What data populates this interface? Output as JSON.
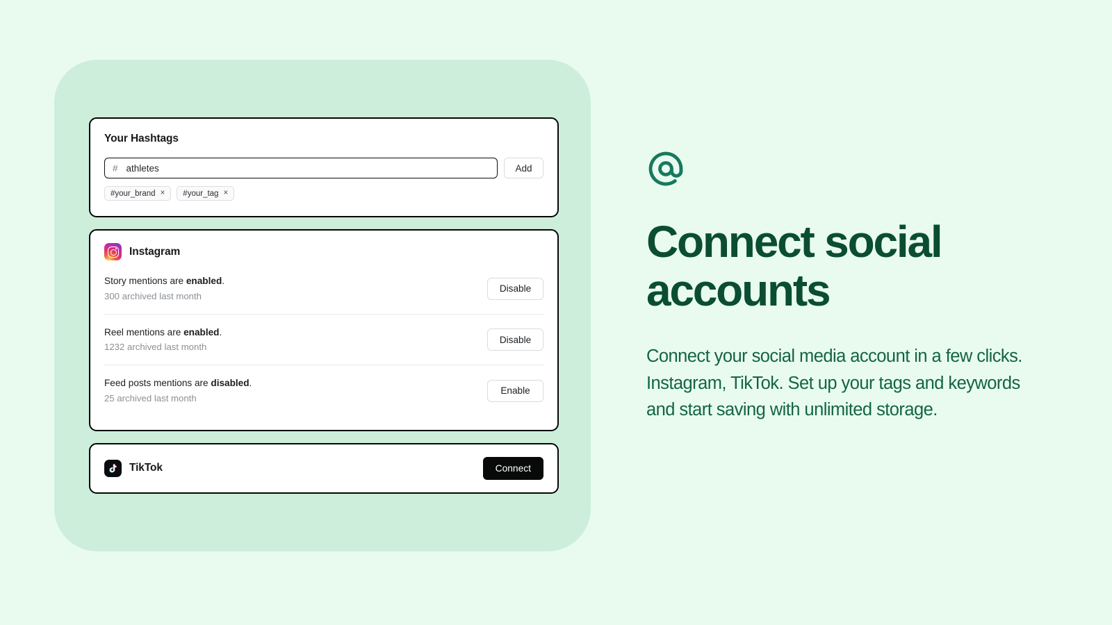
{
  "panel": {
    "background_color": "#cdeeda",
    "page_background_color": "#e9fbef"
  },
  "hashtags_card": {
    "title": "Your Hashtags",
    "input": {
      "prefix": "#",
      "value": "athletes",
      "placeholder": "athletes"
    },
    "add_label": "Add",
    "chips": [
      {
        "label": "#your_brand",
        "remove": "×"
      },
      {
        "label": "#your_tag",
        "remove": "×"
      }
    ]
  },
  "instagram_card": {
    "name": "Instagram",
    "icon": "instagram-icon",
    "rows": [
      {
        "text_prefix": "Story mentions are ",
        "status": "enabled",
        "text_suffix": ".",
        "sub": "300 archived last month",
        "action": "Disable"
      },
      {
        "text_prefix": "Reel mentions are ",
        "status": "enabled",
        "text_suffix": ".",
        "sub": "1232 archived last month",
        "action": "Disable"
      },
      {
        "text_prefix": "Feed posts mentions are ",
        "status": "disabled",
        "text_suffix": ".",
        "sub": "25 archived last month",
        "action": "Enable"
      }
    ]
  },
  "tiktok_card": {
    "name": "TikTok",
    "icon": "tiktok-icon",
    "action": "Connect"
  },
  "marketing": {
    "icon": "at-sign-icon",
    "icon_color": "#17795e",
    "headline": "Connect social accounts",
    "headline_color": "#0a4d33",
    "body": "Connect your social media account in a few clicks. Instagram, TikTok. Set up your tags and keywords and start saving with unlimited storage.",
    "body_color": "#136445"
  }
}
